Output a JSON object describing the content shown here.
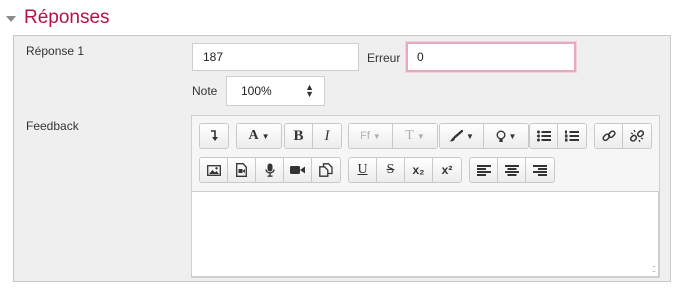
{
  "section": {
    "title": "Réponses"
  },
  "answer": {
    "label": "Réponse 1",
    "value": "187",
    "error_label": "Erreur",
    "error_value": "0",
    "grade_label": "Note",
    "grade_value": "100%"
  },
  "feedback": {
    "label": "Feedback",
    "content": ""
  },
  "toolbar": {
    "font_label": "A",
    "bold": "B",
    "italic": "I",
    "font_family_short": "Ff",
    "font_size_short": "T",
    "underline": "U",
    "strike": "S",
    "subscript": "x₂",
    "superscript": "x²"
  },
  "colors": {
    "accent": "#b3124a",
    "focus": "#e8a9bf"
  }
}
